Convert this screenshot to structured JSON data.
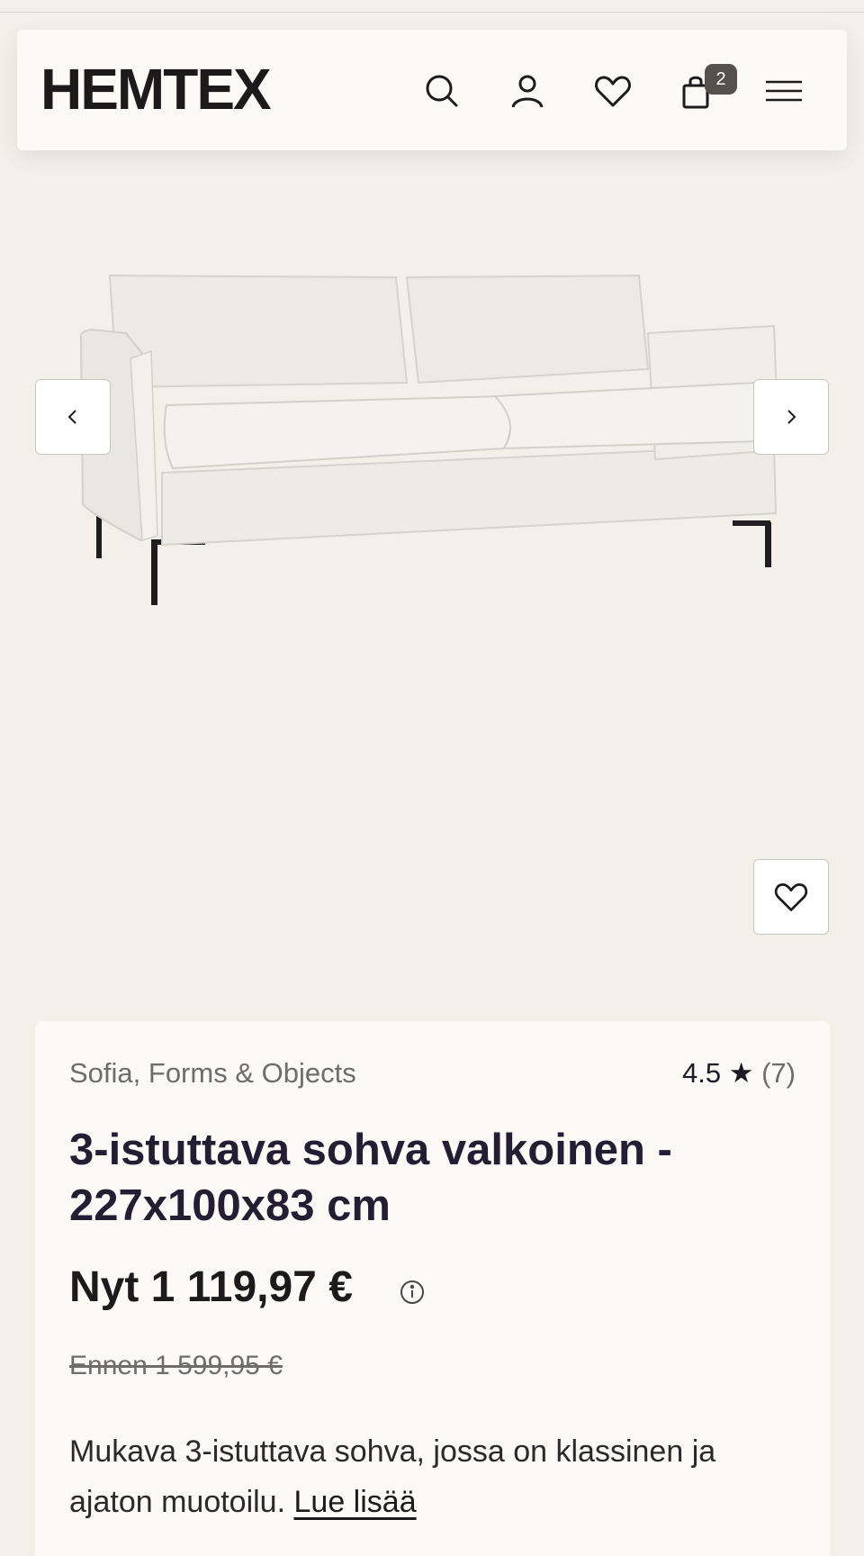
{
  "header": {
    "logo": "HEMTEX",
    "cart_count": "2",
    "icons": [
      "search-icon",
      "user-icon",
      "heart-icon",
      "cart-icon",
      "menu-icon"
    ]
  },
  "gallery": {
    "image_alt": "sofa",
    "prev_icon": "chevron-left-icon",
    "next_icon": "chevron-right-icon",
    "wishlist_icon": "heart-icon"
  },
  "product": {
    "brand": "Sofia, Forms & Objects",
    "rating": "4.5 ★",
    "review_count": "(7)",
    "title": "3-istuttava sohva valkoinen - 227x100x83 cm",
    "price": "Nyt 1 119,97 €",
    "old_price": "Ennen 1 599,95 €",
    "description": "Mukava 3-istuttava sohva, jossa on klassinen ja ajaton muotoilu.",
    "read_more": "Lue lisää"
  },
  "colors": {
    "background": "#f3f0ea",
    "card": "#fbfaf6",
    "badge": "#55504c"
  }
}
